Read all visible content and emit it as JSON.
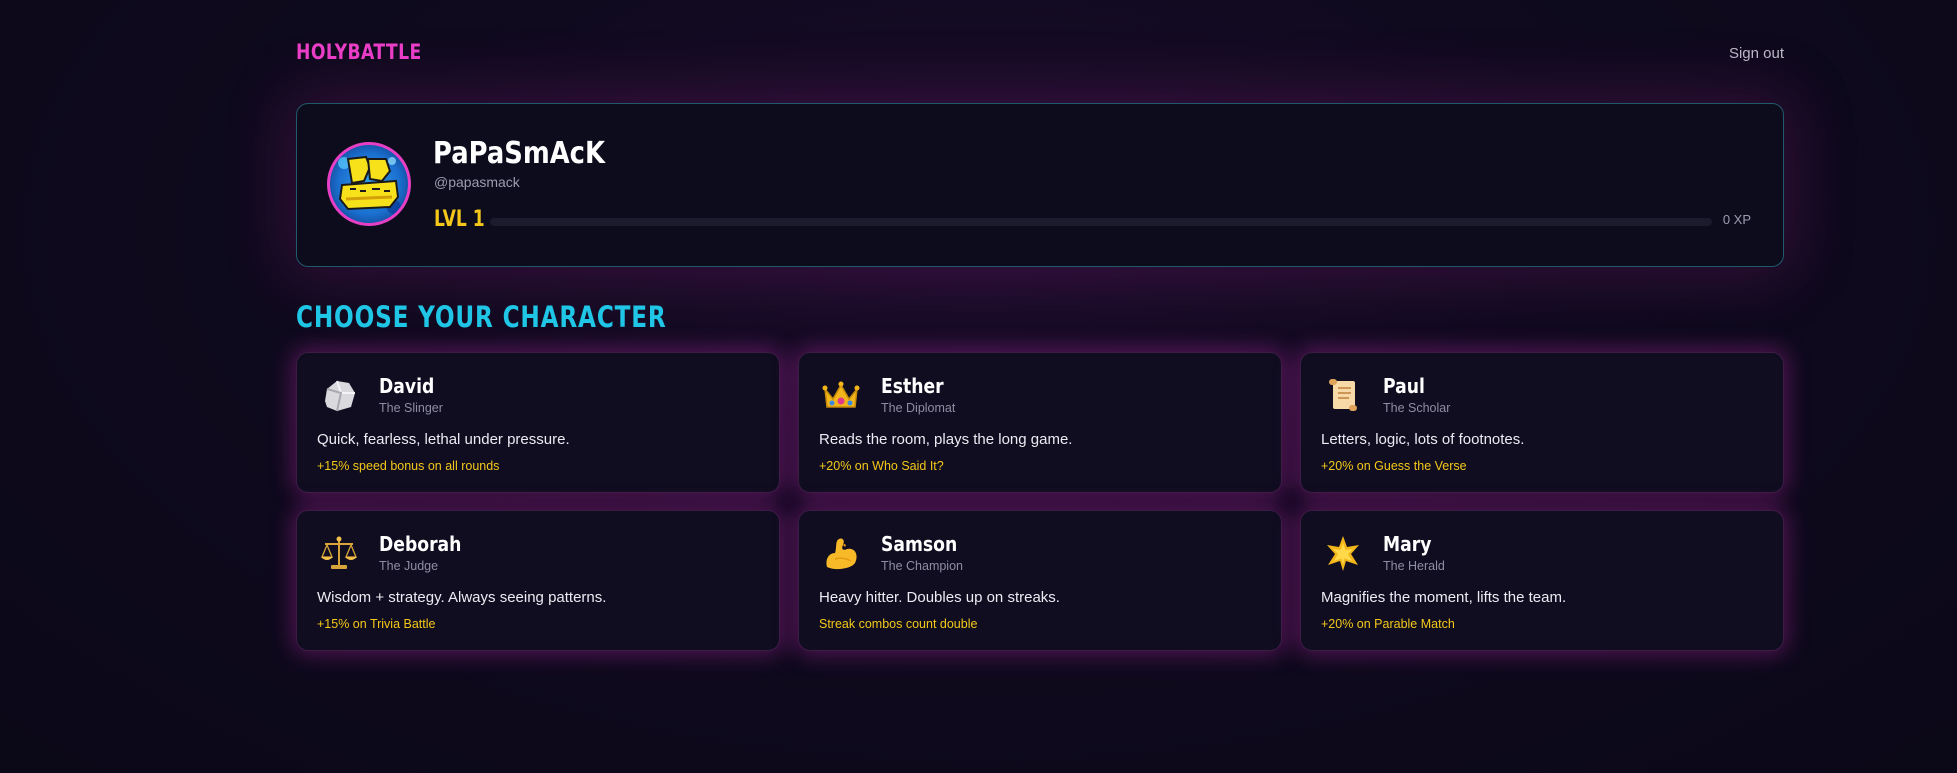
{
  "header": {
    "brand": "HOLYBATTLE",
    "sign_out_label": "Sign out"
  },
  "profile": {
    "avatar_icon": "papasmack-graffiti-avatar",
    "display_name": "PaPaSmAcK",
    "handle": "@papasmack",
    "level_label": "LVL 1",
    "xp_label": "0 XP",
    "xp_progress": 0
  },
  "characters_section": {
    "title": "CHOOSE YOUR CHARACTER",
    "characters": [
      {
        "name": "David",
        "title": "The Slinger",
        "description": "Quick, fearless, lethal under pressure.",
        "bonus": "+15% speed bonus on all rounds",
        "icon": "rock-icon"
      },
      {
        "name": "Esther",
        "title": "The Diplomat",
        "description": "Reads the room, plays the long game.",
        "bonus": "+20% on Who Said It?",
        "icon": "crown-icon"
      },
      {
        "name": "Paul",
        "title": "The Scholar",
        "description": "Letters, logic, lots of footnotes.",
        "bonus": "+20% on Guess the Verse",
        "icon": "scroll-icon"
      },
      {
        "name": "Deborah",
        "title": "The Judge",
        "description": "Wisdom + strategy. Always seeing patterns.",
        "bonus": "+15% on Trivia Battle",
        "icon": "scales-icon"
      },
      {
        "name": "Samson",
        "title": "The Champion",
        "description": "Heavy hitter. Doubles up on streaks.",
        "bonus": "Streak combos count double",
        "icon": "flexed-bicep-icon"
      },
      {
        "name": "Mary",
        "title": "The Herald",
        "description": "Magnifies the moment, lifts the team.",
        "bonus": "+20% on Parable Match",
        "icon": "glowing-star-icon"
      }
    ]
  },
  "colors": {
    "brand": "#ec3fc8",
    "accent_cyan": "#1fc6e6",
    "gold": "#f4c81a",
    "background": "#0f0a1e"
  }
}
